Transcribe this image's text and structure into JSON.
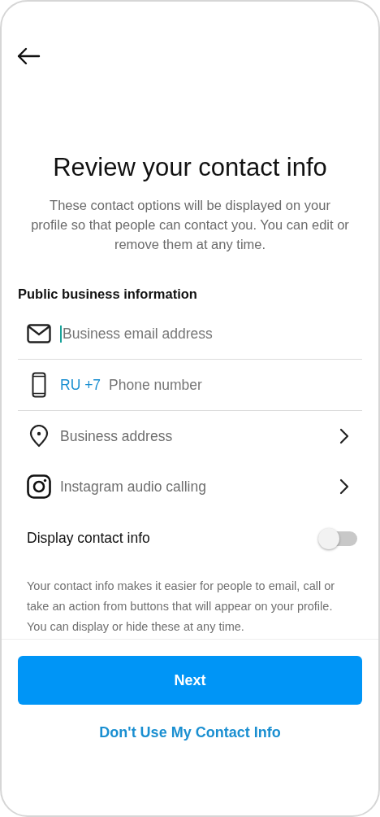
{
  "title": "Review your contact info",
  "description": "These contact options will be displayed on your profile so that people can contact you. You can edit or remove them at any time.",
  "section": "Public business information",
  "rows": [
    {
      "kind": "email",
      "placeholder": "Business email address",
      "focused": true
    },
    {
      "kind": "phone",
      "prefix": "RU +7",
      "placeholder": "Phone number"
    },
    {
      "kind": "address",
      "label": "Business address"
    },
    {
      "kind": "calling",
      "label": "Instagram audio calling"
    }
  ],
  "toggle": {
    "label": "Display contact info",
    "on": false
  },
  "help": "Your contact info makes it easier for people to email, call or take an action from buttons that will appear on your profile. You can display or hide these at any time.",
  "primary_button": "Next",
  "secondary_link": "Don't Use My Contact Info"
}
